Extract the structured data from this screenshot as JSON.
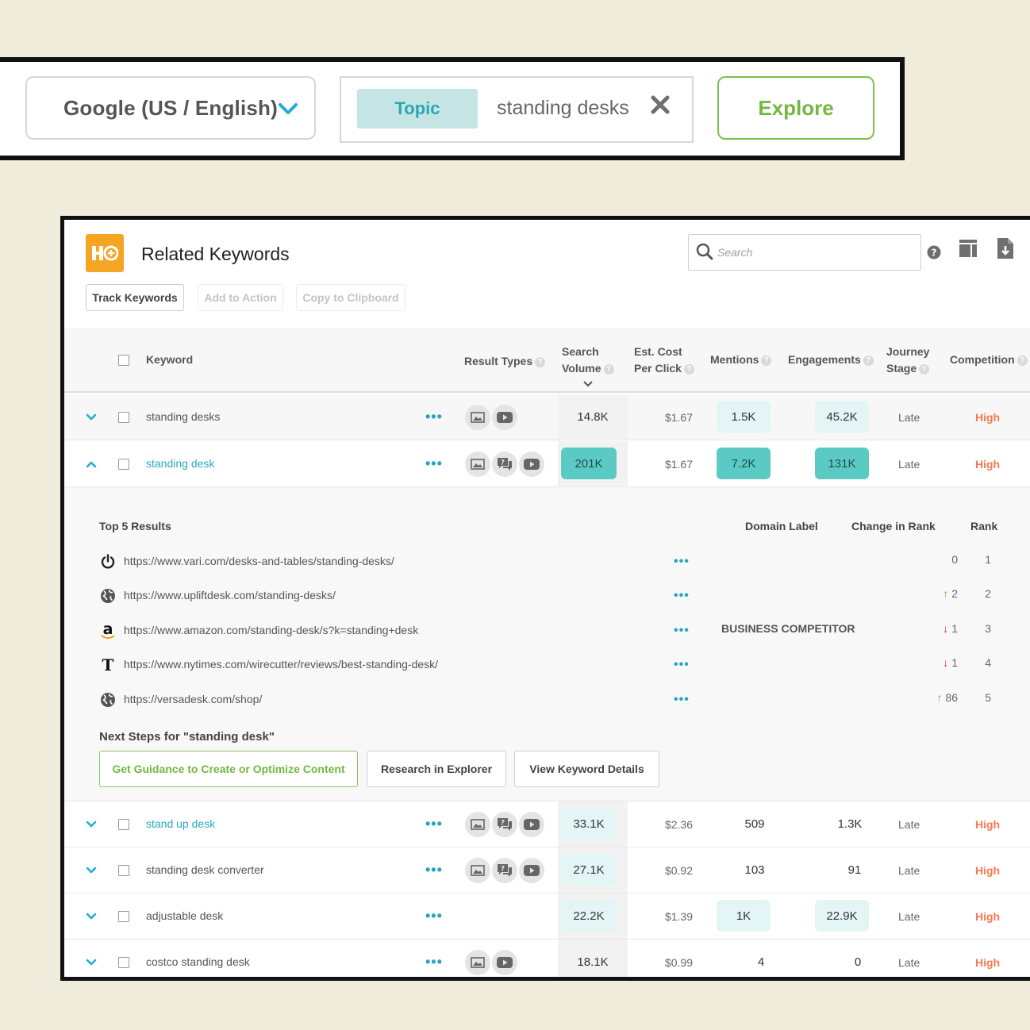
{
  "top_bar": {
    "engine_label": "Google (US / English)",
    "query_type": "Topic",
    "query_text": "standing desks",
    "explore_label": "Explore"
  },
  "panel": {
    "title": "Related Keywords",
    "search_placeholder": "Search",
    "actions": {
      "track": "Track Keywords",
      "add": "Add to Action",
      "copy": "Copy to Clipboard"
    },
    "columns": {
      "keyword": "Keyword",
      "result_types": "Result Types",
      "search_volume_1": "Search",
      "search_volume_2": "Volume",
      "cost_1": "Est. Cost",
      "cost_2": "Per Click",
      "mentions": "Mentions",
      "engagements": "Engagements",
      "journey_1": "Journey",
      "journey_2": "Stage",
      "competition": "Competition"
    },
    "rows": [
      {
        "keyword": "standing desks",
        "dots": "•••",
        "volume": "14.8K",
        "cost": "$1.67",
        "mentions": "1.5K",
        "engagements": "45.2K",
        "stage": "Late",
        "competition": "High"
      },
      {
        "keyword": "standing desk",
        "dots": "•••",
        "volume": "201K",
        "cost": "$1.67",
        "mentions": "7.2K",
        "engagements": "131K",
        "stage": "Late",
        "competition": "High"
      },
      {
        "keyword": "stand up desk",
        "dots": "•••",
        "volume": "33.1K",
        "cost": "$2.36",
        "mentions": "509",
        "engagements": "1.3K",
        "stage": "Late",
        "competition": "High"
      },
      {
        "keyword": "standing desk converter",
        "dots": "•••",
        "volume": "27.1K",
        "cost": "$0.92",
        "mentions": "103",
        "engagements": "91",
        "stage": "Late",
        "competition": "High"
      },
      {
        "keyword": "adjustable desk",
        "dots": "•••",
        "volume": "22.2K",
        "cost": "$1.39",
        "mentions": "1K",
        "engagements": "22.9K",
        "stage": "Late",
        "competition": "High"
      },
      {
        "keyword": "costco standing desk",
        "dots": "•••",
        "volume": "18.1K",
        "cost": "$0.99",
        "mentions": "4",
        "engagements": "0",
        "stage": "Late",
        "competition": "High"
      }
    ],
    "expanded": {
      "title": "Top 5 Results",
      "col_domain": "Domain Label",
      "col_change": "Change in Rank",
      "col_rank": "Rank",
      "results": [
        {
          "url": "https://www.vari.com/desks-and-tables/standing-desks/",
          "dots": "•••",
          "label": "",
          "arrow": "",
          "change": "0",
          "rank": "1"
        },
        {
          "url": "https://www.upliftdesk.com/standing-desks/",
          "dots": "•••",
          "label": "",
          "arrow": "↑",
          "change": "2",
          "rank": "2"
        },
        {
          "url": "https://www.amazon.com/standing-desk/s?k=standing+desk",
          "dots": "•••",
          "label": "BUSINESS COMPETITOR",
          "arrow": "↓",
          "change": "1",
          "rank": "3"
        },
        {
          "url": "https://www.nytimes.com/wirecutter/reviews/best-standing-desk/",
          "dots": "•••",
          "label": "",
          "arrow": "↓",
          "change": "1",
          "rank": "4"
        },
        {
          "url": "https://versadesk.com/shop/",
          "dots": "•••",
          "label": "",
          "arrow": "↑",
          "change": "86",
          "rank": "5"
        }
      ],
      "next_steps_title": "Next Steps for \"standing desk\"",
      "buttons": {
        "guidance": "Get Guidance to Create or Optimize Content",
        "research": "Research in Explorer",
        "details": "View Keyword Details"
      }
    }
  },
  "icons": {
    "engine_dropdown": "chevron-down-icon",
    "clear": "close-icon",
    "search": "search-icon",
    "help": "help-icon",
    "columns": "columns-icon",
    "export": "export-icon",
    "result_types": [
      "image-icon",
      "qa-icon",
      "video-icon"
    ],
    "result_sites": [
      "power-icon",
      "globe-icon",
      "amazon-icon",
      "nytimes-icon",
      "globe-icon"
    ]
  },
  "colors": {
    "accent_teal": "#29a8c3",
    "explore_green": "#74b83f",
    "competition_high": "#f27a52",
    "cell_light": "#e4f5f5",
    "cell_strong": "#5ccac4",
    "logo_orange": "#f5a524",
    "rank_up": "#66b33c",
    "rank_down": "#d23b2c"
  }
}
